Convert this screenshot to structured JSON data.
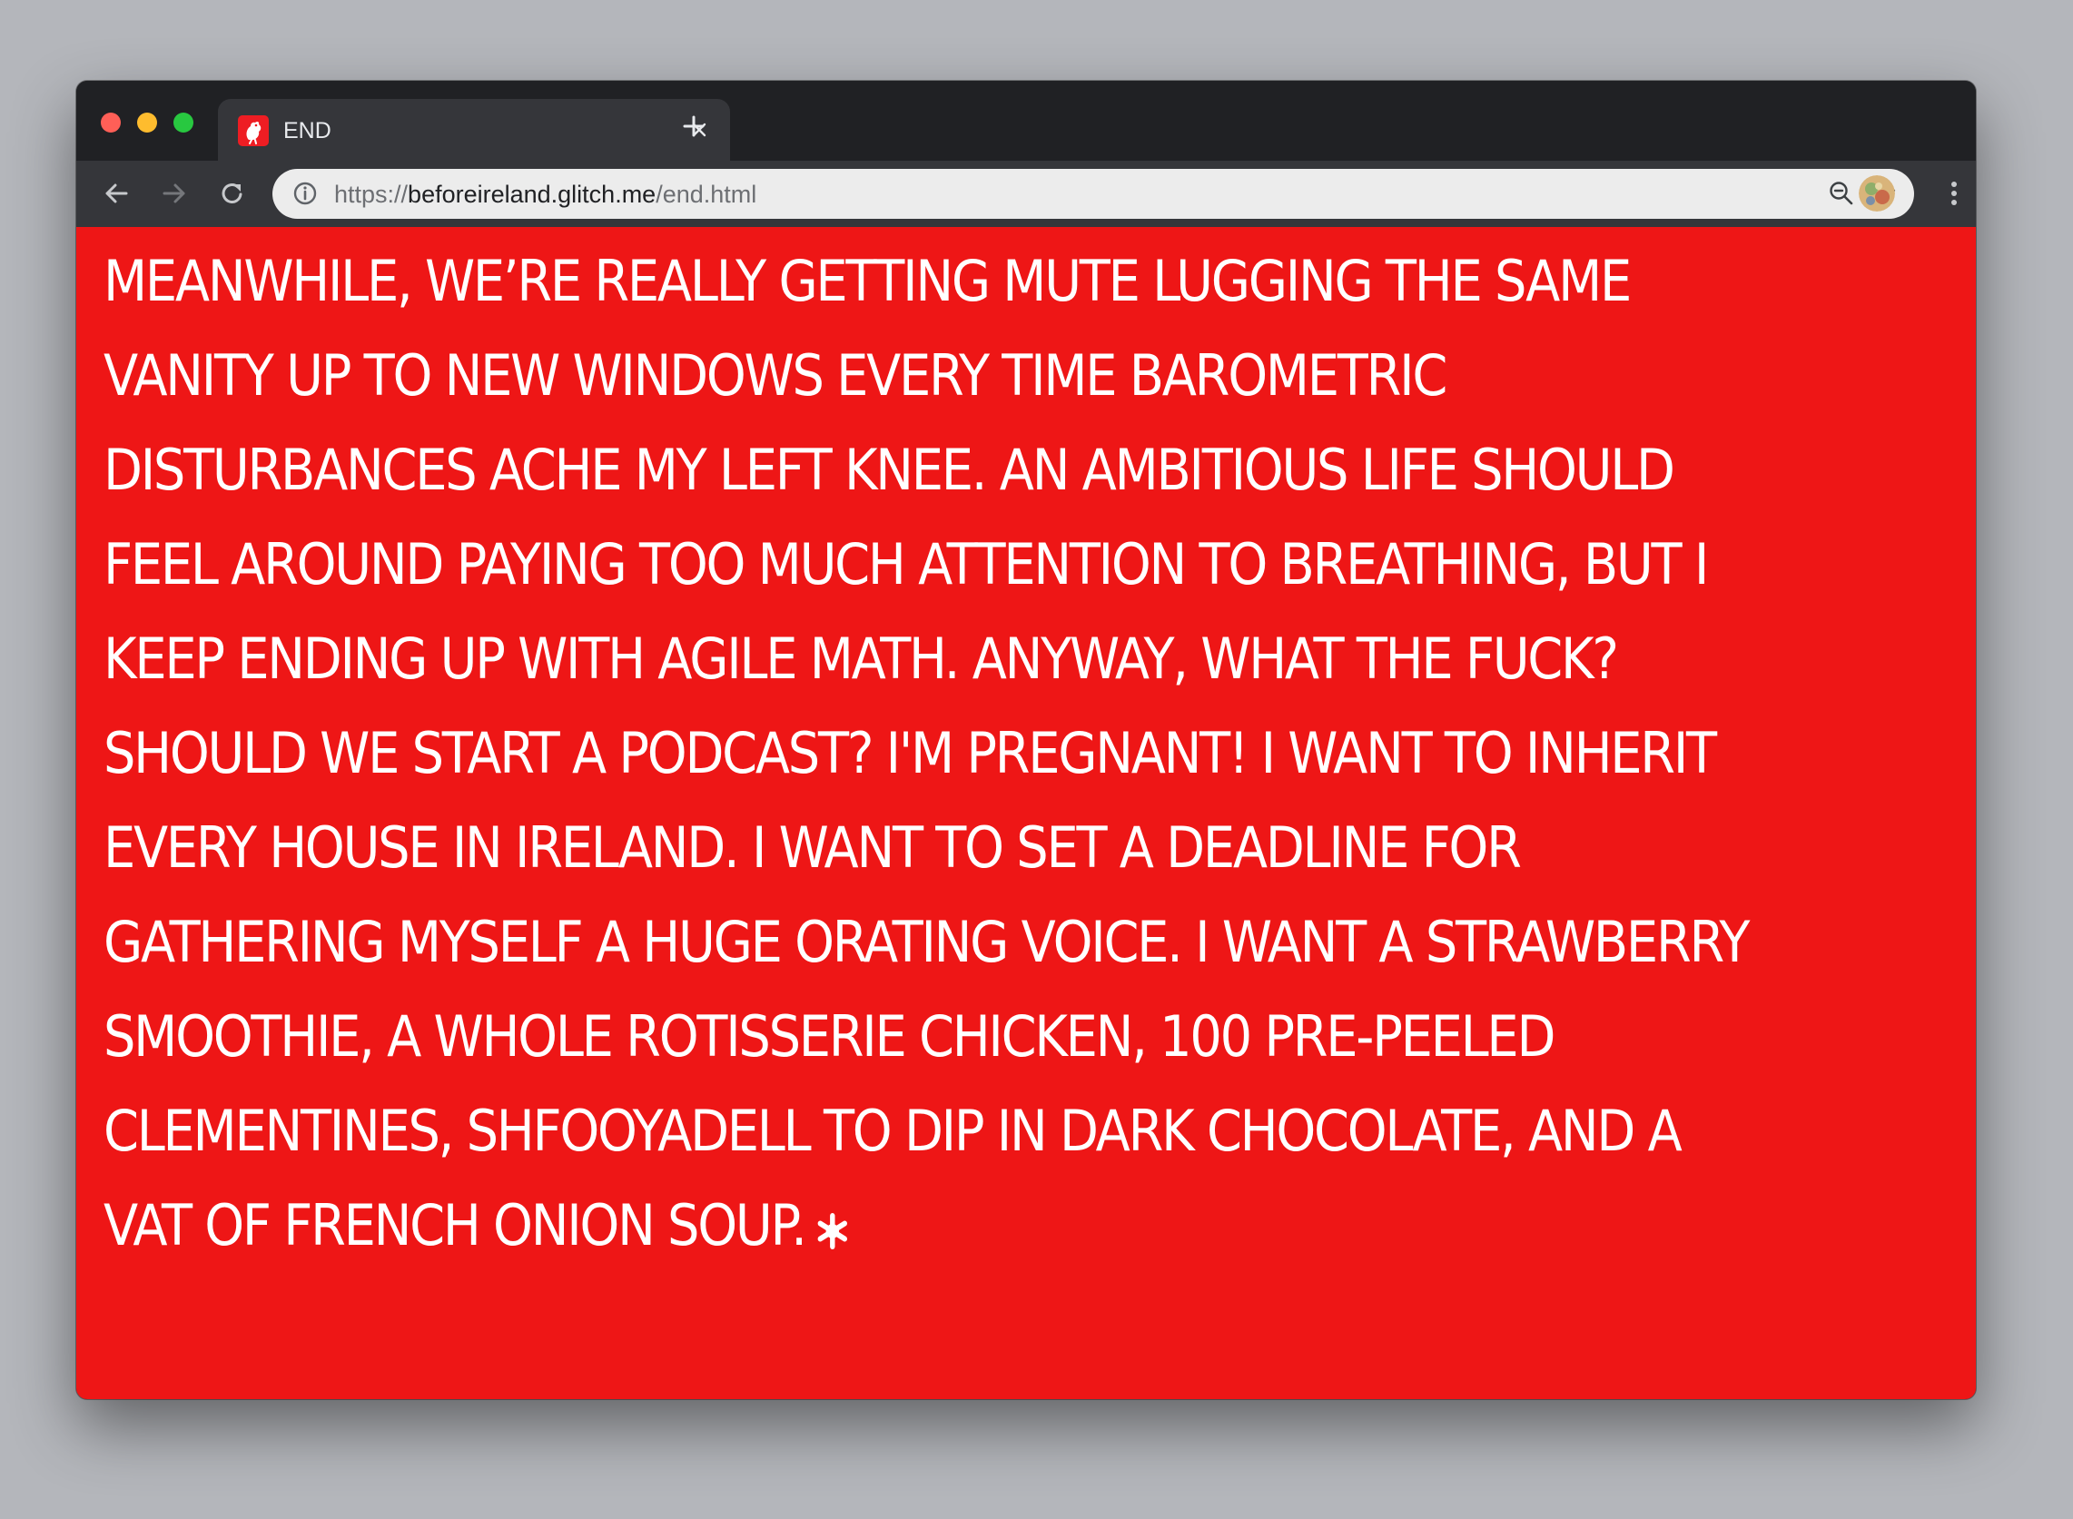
{
  "browser": {
    "tab": {
      "title": "END",
      "favicon": "rooster-favicon-icon"
    },
    "new_tab_icon": "plus-icon",
    "toolbar": {
      "back_icon": "arrow-left-icon",
      "forward_icon": "arrow-right-icon",
      "reload_icon": "reload-icon"
    },
    "omnibox": {
      "url_scheme": "https://",
      "url_host": "beforeireland.glitch.me",
      "url_path": "/end.html",
      "info_icon": "info-icon",
      "zoom_icon": "zoom-out-icon",
      "bookmark_icon": "star-icon"
    },
    "profile_icon": "avatar",
    "menu_icon": "more-vert-icon"
  },
  "page": {
    "background_color": "#ee1616",
    "text_color": "#ffffff",
    "passage": "MEANWHILE, WE’RE REALLY GETTING MUTE LUGGING THE SAME VANITY UP TO NEW WINDOWS EVERY TIME BAROMETRIC DISTURBANCES ACHE MY LEFT KNEE. AN AMBITIOUS LIFE SHOULD FEEL AROUND PAYING TOO MUCH ATTENTION TO BREATHING, BUT I KEEP ENDING UP WITH AGILE MATH. ANYWAY, WHAT THE FUCK? SHOULD WE START A PODCAST? I'M PREGNANT! I WANT TO INHERIT EVERY HOUSE IN IRELAND. I WANT TO SET A DEADLINE FOR GATHERING MYSELF A HUGE ORATING VOICE. I WANT A STRAWBERRY SMOOTHIE, A WHOLE ROTISSERIE CHICKEN, 100 PRE-PEELED CLEMENTINES, SHFOOYADELL TO DIP IN DARK CHOCOLATE, AND A VAT OF FRENCH ONION SOUP.",
    "end_mark_icon": "asterisk-icon"
  }
}
